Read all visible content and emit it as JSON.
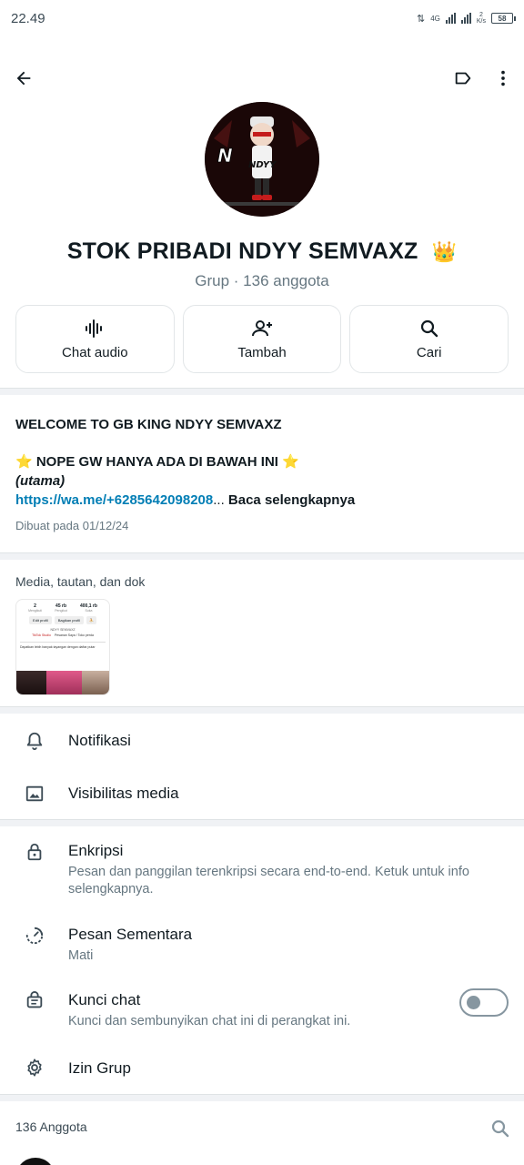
{
  "status_bar": {
    "time": "22.49",
    "network": "4G",
    "speed_value": "2",
    "speed_unit": "K/s",
    "battery": "58"
  },
  "header": {
    "back_icon": "arrow-left-icon",
    "label_icon": "label-tag-icon",
    "menu_icon": "more-vert-icon"
  },
  "group": {
    "name": "STOK PRIBADI NDYY SEMVAXZ",
    "emoji": "👑",
    "subtitle": "Grup · 136 anggota",
    "avatar_text": "NDYY"
  },
  "actions": [
    {
      "label": "Chat audio",
      "icon": "audio-wave-icon"
    },
    {
      "label": "Tambah",
      "icon": "add-person-icon"
    },
    {
      "label": "Cari",
      "icon": "search-icon"
    }
  ],
  "description": {
    "line1": "WELCOME TO GB KING NDYY SEMVAXZ",
    "line2": "⭐ NOPE GW HANYA ADA DI BAWAH INI ⭐",
    "line3": "(utama)",
    "link": "https://wa.me/+6285642098208",
    "ellipsis": "...",
    "read_more": " Baca selengkapnya",
    "created": "Dibuat pada 01/12/24"
  },
  "media": {
    "label": "Media, tautan, dan dok",
    "thumb": {
      "stat1_value": "2",
      "stat1_label": "Mengikuti",
      "stat2_value": "45 rb",
      "stat2_label": "Pengikut",
      "stat3_value": "400,1 rb",
      "stat3_label": "Suka",
      "btn1": "Edit profil",
      "btn2": "Bagikan profil",
      "username": "NDYY SEMVAXZ",
      "link1": "TikTok Studio",
      "link2": "Pesanan Saya / Toko perda",
      "note": "Dapatkan lebih banyak tayangan dengan daftar putar"
    }
  },
  "settings": {
    "notifications": {
      "title": "Notifikasi",
      "icon": "bell-icon"
    },
    "media_visibility": {
      "title": "Visibilitas media",
      "icon": "image-icon"
    },
    "encryption": {
      "title": "Enkripsi",
      "subtitle": "Pesan dan panggilan terenkripsi secara end-to-end. Ketuk untuk info selengkapnya.",
      "icon": "lock-icon"
    },
    "disappearing": {
      "title": "Pesan Sementara",
      "subtitle": "Mati",
      "icon": "timer-icon"
    },
    "chat_lock": {
      "title": "Kunci chat",
      "subtitle": "Kunci dan sembunyikan chat ini di perangkat ini.",
      "icon": "chat-lock-icon",
      "enabled": false
    },
    "group_permissions": {
      "title": "Izin Grup",
      "icon": "gear-icon"
    }
  },
  "members": {
    "label": "136 Anggota",
    "search_icon": "search-icon"
  },
  "colors": {
    "link": "#027eb5",
    "muted": "#667781",
    "divider": "#f0f2f5",
    "text": "#111b21"
  }
}
